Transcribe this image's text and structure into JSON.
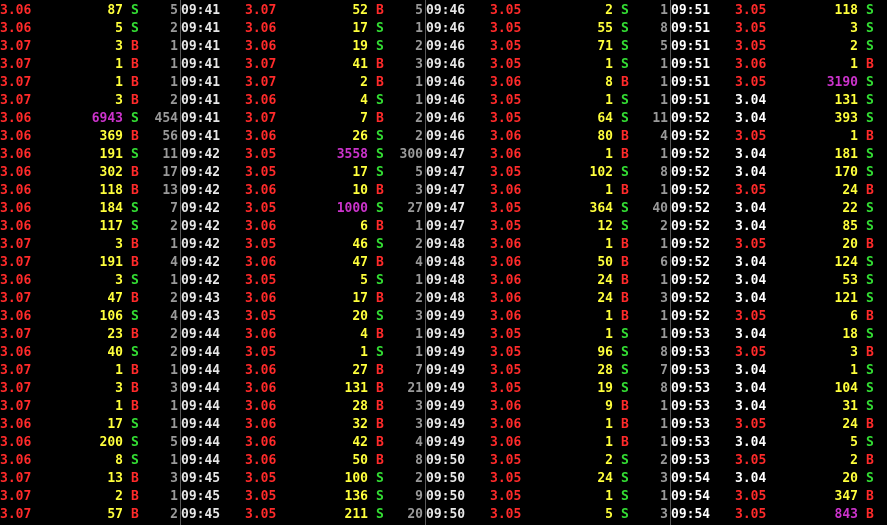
{
  "colors": {
    "price_up": "#ff2a2a",
    "price_flat": "#ffffff",
    "volume": "#ffff3c",
    "volume_large": "#cc33cc",
    "side_sell": "#33dd33",
    "side_buy": "#ff2a2a",
    "count": "#9a9a9a",
    "time": "#e8e8e8"
  },
  "columns": [
    {
      "rows": [
        {
          "price": "3.06",
          "vol": "87",
          "side": "S",
          "count": "5",
          "time": "09:41"
        },
        {
          "price": "3.06",
          "vol": "5",
          "side": "S",
          "count": "2",
          "time": "09:41"
        },
        {
          "price": "3.07",
          "vol": "3",
          "side": "B",
          "count": "1",
          "time": "09:41"
        },
        {
          "price": "3.07",
          "vol": "1",
          "side": "B",
          "count": "1",
          "time": "09:41"
        },
        {
          "price": "3.07",
          "vol": "1",
          "side": "B",
          "count": "1",
          "time": "09:41"
        },
        {
          "price": "3.07",
          "vol": "3",
          "side": "B",
          "count": "2",
          "time": "09:41"
        },
        {
          "price": "3.06",
          "vol": "6943",
          "side": "S",
          "count": "454",
          "time": "09:41",
          "big": true
        },
        {
          "price": "3.06",
          "vol": "369",
          "side": "B",
          "count": "56",
          "time": "09:41"
        },
        {
          "price": "3.06",
          "vol": "191",
          "side": "S",
          "count": "11",
          "time": "09:42"
        },
        {
          "price": "3.06",
          "vol": "302",
          "side": "B",
          "count": "17",
          "time": "09:42"
        },
        {
          "price": "3.06",
          "vol": "118",
          "side": "B",
          "count": "13",
          "time": "09:42"
        },
        {
          "price": "3.06",
          "vol": "184",
          "side": "S",
          "count": "7",
          "time": "09:42"
        },
        {
          "price": "3.06",
          "vol": "117",
          "side": "S",
          "count": "2",
          "time": "09:42"
        },
        {
          "price": "3.07",
          "vol": "3",
          "side": "B",
          "count": "1",
          "time": "09:42"
        },
        {
          "price": "3.07",
          "vol": "191",
          "side": "B",
          "count": "4",
          "time": "09:42"
        },
        {
          "price": "3.06",
          "vol": "3",
          "side": "S",
          "count": "1",
          "time": "09:42"
        },
        {
          "price": "3.07",
          "vol": "47",
          "side": "B",
          "count": "2",
          "time": "09:43"
        },
        {
          "price": "3.06",
          "vol": "106",
          "side": "S",
          "count": "4",
          "time": "09:43"
        },
        {
          "price": "3.07",
          "vol": "23",
          "side": "B",
          "count": "2",
          "time": "09:44"
        },
        {
          "price": "3.06",
          "vol": "40",
          "side": "S",
          "count": "2",
          "time": "09:44"
        },
        {
          "price": "3.07",
          "vol": "1",
          "side": "B",
          "count": "1",
          "time": "09:44"
        },
        {
          "price": "3.07",
          "vol": "3",
          "side": "B",
          "count": "3",
          "time": "09:44"
        },
        {
          "price": "3.07",
          "vol": "1",
          "side": "B",
          "count": "1",
          "time": "09:44"
        },
        {
          "price": "3.06",
          "vol": "17",
          "side": "S",
          "count": "1",
          "time": "09:44"
        },
        {
          "price": "3.06",
          "vol": "200",
          "side": "S",
          "count": "5",
          "time": "09:44"
        },
        {
          "price": "3.06",
          "vol": "8",
          "side": "S",
          "count": "1",
          "time": "09:44"
        },
        {
          "price": "3.07",
          "vol": "13",
          "side": "B",
          "count": "3",
          "time": "09:45"
        },
        {
          "price": "3.07",
          "vol": "2",
          "side": "B",
          "count": "1",
          "time": "09:45"
        },
        {
          "price": "3.07",
          "vol": "57",
          "side": "B",
          "count": "2",
          "time": "09:45"
        }
      ]
    },
    {
      "rows": [
        {
          "price": "3.07",
          "vol": "52",
          "side": "B",
          "count": "5",
          "time": "09:46"
        },
        {
          "price": "3.06",
          "vol": "17",
          "side": "S",
          "count": "1",
          "time": "09:46"
        },
        {
          "price": "3.06",
          "vol": "19",
          "side": "S",
          "count": "2",
          "time": "09:46"
        },
        {
          "price": "3.07",
          "vol": "41",
          "side": "B",
          "count": "3",
          "time": "09:46"
        },
        {
          "price": "3.07",
          "vol": "2",
          "side": "B",
          "count": "1",
          "time": "09:46"
        },
        {
          "price": "3.06",
          "vol": "4",
          "side": "S",
          "count": "1",
          "time": "09:46"
        },
        {
          "price": "3.07",
          "vol": "7",
          "side": "B",
          "count": "2",
          "time": "09:46"
        },
        {
          "price": "3.06",
          "vol": "26",
          "side": "S",
          "count": "2",
          "time": "09:46"
        },
        {
          "price": "3.05",
          "vol": "3558",
          "side": "S",
          "count": "300",
          "time": "09:47",
          "big": true
        },
        {
          "price": "3.05",
          "vol": "17",
          "side": "S",
          "count": "5",
          "time": "09:47"
        },
        {
          "price": "3.06",
          "vol": "10",
          "side": "B",
          "count": "3",
          "time": "09:47"
        },
        {
          "price": "3.05",
          "vol": "1000",
          "side": "S",
          "count": "27",
          "time": "09:47",
          "big": true
        },
        {
          "price": "3.06",
          "vol": "6",
          "side": "B",
          "count": "1",
          "time": "09:47"
        },
        {
          "price": "3.05",
          "vol": "46",
          "side": "S",
          "count": "2",
          "time": "09:48"
        },
        {
          "price": "3.06",
          "vol": "47",
          "side": "B",
          "count": "4",
          "time": "09:48"
        },
        {
          "price": "3.05",
          "vol": "5",
          "side": "S",
          "count": "1",
          "time": "09:48"
        },
        {
          "price": "3.06",
          "vol": "17",
          "side": "B",
          "count": "2",
          "time": "09:48"
        },
        {
          "price": "3.05",
          "vol": "20",
          "side": "S",
          "count": "3",
          "time": "09:49"
        },
        {
          "price": "3.06",
          "vol": "4",
          "side": "B",
          "count": "1",
          "time": "09:49"
        },
        {
          "price": "3.05",
          "vol": "1",
          "side": "S",
          "count": "1",
          "time": "09:49"
        },
        {
          "price": "3.06",
          "vol": "27",
          "side": "B",
          "count": "7",
          "time": "09:49"
        },
        {
          "price": "3.06",
          "vol": "131",
          "side": "B",
          "count": "21",
          "time": "09:49"
        },
        {
          "price": "3.06",
          "vol": "28",
          "side": "B",
          "count": "3",
          "time": "09:49"
        },
        {
          "price": "3.06",
          "vol": "32",
          "side": "B",
          "count": "3",
          "time": "09:49"
        },
        {
          "price": "3.06",
          "vol": "42",
          "side": "B",
          "count": "4",
          "time": "09:49"
        },
        {
          "price": "3.06",
          "vol": "50",
          "side": "B",
          "count": "8",
          "time": "09:50"
        },
        {
          "price": "3.05",
          "vol": "100",
          "side": "S",
          "count": "2",
          "time": "09:50"
        },
        {
          "price": "3.05",
          "vol": "136",
          "side": "S",
          "count": "9",
          "time": "09:50"
        },
        {
          "price": "3.05",
          "vol": "211",
          "side": "S",
          "count": "20",
          "time": "09:50"
        }
      ]
    },
    {
      "rows": [
        {
          "price": "3.05",
          "vol": "2",
          "side": "S",
          "count": "1",
          "time": "09:51"
        },
        {
          "price": "3.05",
          "vol": "55",
          "side": "S",
          "count": "8",
          "time": "09:51"
        },
        {
          "price": "3.05",
          "vol": "71",
          "side": "S",
          "count": "5",
          "time": "09:51"
        },
        {
          "price": "3.05",
          "vol": "1",
          "side": "S",
          "count": "1",
          "time": "09:51"
        },
        {
          "price": "3.06",
          "vol": "8",
          "side": "B",
          "count": "1",
          "time": "09:51"
        },
        {
          "price": "3.05",
          "vol": "1",
          "side": "S",
          "count": "1",
          "time": "09:51"
        },
        {
          "price": "3.05",
          "vol": "64",
          "side": "S",
          "count": "11",
          "time": "09:52"
        },
        {
          "price": "3.06",
          "vol": "80",
          "side": "B",
          "count": "4",
          "time": "09:52"
        },
        {
          "price": "3.06",
          "vol": "1",
          "side": "B",
          "count": "1",
          "time": "09:52"
        },
        {
          "price": "3.05",
          "vol": "102",
          "side": "S",
          "count": "8",
          "time": "09:52"
        },
        {
          "price": "3.06",
          "vol": "1",
          "side": "B",
          "count": "1",
          "time": "09:52"
        },
        {
          "price": "3.05",
          "vol": "364",
          "side": "S",
          "count": "40",
          "time": "09:52"
        },
        {
          "price": "3.05",
          "vol": "12",
          "side": "S",
          "count": "2",
          "time": "09:52"
        },
        {
          "price": "3.06",
          "vol": "1",
          "side": "B",
          "count": "1",
          "time": "09:52"
        },
        {
          "price": "3.06",
          "vol": "50",
          "side": "B",
          "count": "6",
          "time": "09:52"
        },
        {
          "price": "3.06",
          "vol": "24",
          "side": "B",
          "count": "1",
          "time": "09:52"
        },
        {
          "price": "3.06",
          "vol": "24",
          "side": "B",
          "count": "3",
          "time": "09:52"
        },
        {
          "price": "3.06",
          "vol": "1",
          "side": "B",
          "count": "1",
          "time": "09:52"
        },
        {
          "price": "3.05",
          "vol": "1",
          "side": "S",
          "count": "1",
          "time": "09:53"
        },
        {
          "price": "3.05",
          "vol": "96",
          "side": "S",
          "count": "8",
          "time": "09:53"
        },
        {
          "price": "3.05",
          "vol": "28",
          "side": "S",
          "count": "7",
          "time": "09:53"
        },
        {
          "price": "3.05",
          "vol": "19",
          "side": "S",
          "count": "8",
          "time": "09:53"
        },
        {
          "price": "3.06",
          "vol": "9",
          "side": "B",
          "count": "1",
          "time": "09:53"
        },
        {
          "price": "3.06",
          "vol": "1",
          "side": "B",
          "count": "1",
          "time": "09:53"
        },
        {
          "price": "3.06",
          "vol": "1",
          "side": "B",
          "count": "1",
          "time": "09:53"
        },
        {
          "price": "3.05",
          "vol": "2",
          "side": "S",
          "count": "2",
          "time": "09:53"
        },
        {
          "price": "3.05",
          "vol": "24",
          "side": "S",
          "count": "3",
          "time": "09:54"
        },
        {
          "price": "3.05",
          "vol": "1",
          "side": "S",
          "count": "1",
          "time": "09:54"
        },
        {
          "price": "3.05",
          "vol": "5",
          "side": "S",
          "count": "3",
          "time": "09:54"
        }
      ]
    },
    {
      "rows": [
        {
          "price": "3.05",
          "vol": "118",
          "side": "S"
        },
        {
          "price": "3.05",
          "vol": "3",
          "side": "S"
        },
        {
          "price": "3.05",
          "vol": "2",
          "side": "S"
        },
        {
          "price": "3.06",
          "vol": "1",
          "side": "B"
        },
        {
          "price": "3.05",
          "vol": "3190",
          "side": "S",
          "big": true
        },
        {
          "price": "3.04",
          "vol": "131",
          "side": "S"
        },
        {
          "price": "3.04",
          "vol": "393",
          "side": "S"
        },
        {
          "price": "3.05",
          "vol": "1",
          "side": "B"
        },
        {
          "price": "3.04",
          "vol": "181",
          "side": "S"
        },
        {
          "price": "3.04",
          "vol": "170",
          "side": "S"
        },
        {
          "price": "3.05",
          "vol": "24",
          "side": "B"
        },
        {
          "price": "3.04",
          "vol": "22",
          "side": "S"
        },
        {
          "price": "3.04",
          "vol": "85",
          "side": "S"
        },
        {
          "price": "3.05",
          "vol": "20",
          "side": "B"
        },
        {
          "price": "3.04",
          "vol": "124",
          "side": "S"
        },
        {
          "price": "3.04",
          "vol": "53",
          "side": "S"
        },
        {
          "price": "3.04",
          "vol": "121",
          "side": "S"
        },
        {
          "price": "3.05",
          "vol": "6",
          "side": "B"
        },
        {
          "price": "3.04",
          "vol": "18",
          "side": "S"
        },
        {
          "price": "3.05",
          "vol": "3",
          "side": "B"
        },
        {
          "price": "3.04",
          "vol": "1",
          "side": "S"
        },
        {
          "price": "3.04",
          "vol": "104",
          "side": "S"
        },
        {
          "price": "3.04",
          "vol": "31",
          "side": "S"
        },
        {
          "price": "3.05",
          "vol": "24",
          "side": "B"
        },
        {
          "price": "3.04",
          "vol": "5",
          "side": "S"
        },
        {
          "price": "3.05",
          "vol": "2",
          "side": "B"
        },
        {
          "price": "3.04",
          "vol": "20",
          "side": "S"
        },
        {
          "price": "3.05",
          "vol": "347",
          "side": "B"
        },
        {
          "price": "3.05",
          "vol": "843",
          "side": "B",
          "big": true
        }
      ]
    }
  ]
}
